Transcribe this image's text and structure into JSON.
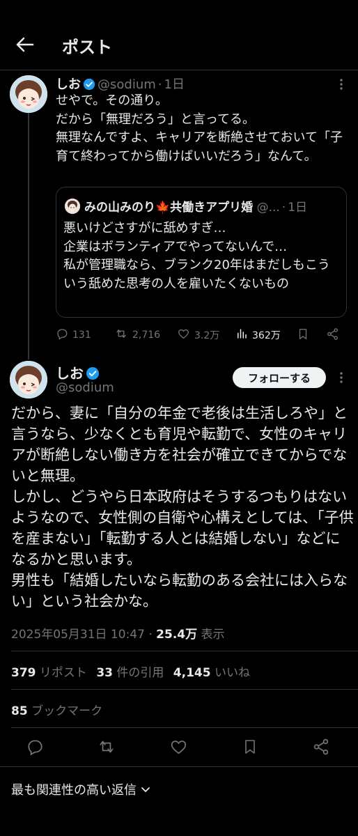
{
  "header": {
    "title": "ポスト"
  },
  "tweet1": {
    "name": "しお",
    "handle": "@sodium",
    "dot": "·",
    "time": "1日",
    "text": "せやで。その通り。\nだから「無理だろう」と言ってる。\n無理なんですよ、キャリアを断絶させておいて「子育て終わってから働けばいいだろう」なんて。",
    "quote": {
      "name": "みの山みのり🍁共働きアプリ婚",
      "handle": "@...",
      "dot": "·",
      "time": "1日",
      "text": "悪いけどさすがに舐めすぎ…\n企業はボランティアでやってないんで…\n私が管理職なら、ブランク20年はまだしもこういう舐めた思考の人を雇いたくないもの"
    },
    "actions": {
      "replies": "131",
      "reposts": "2,716",
      "likes": "3.2万",
      "views": "362万"
    }
  },
  "tweet2": {
    "name": "しお",
    "handle": "@sodium",
    "follow_label": "フォローする",
    "text": "だから、妻に「自分の年金で老後は生活しろや」と言うなら、少なくとも育児や転勤で、女性のキャリアが断絶しない働き方を社会が確立できてからでないと無理。\nしかし、どうやら日本政府はそうするつもりはないようなので、女性側の自衛や心構えとしては、「子供を産まない」「転勤する人とは結婚しない」などになるかと思います。\n男性も「結婚したいなら転勤のある会社には入らない」という社会かな。",
    "timestamp": "2025年05月31日 10:47",
    "sep": "·",
    "views": "25.4万",
    "views_label": "表示",
    "stats": {
      "reposts": "379",
      "reposts_label": "リポスト",
      "quotes": "33",
      "quotes_label": "件の引用",
      "likes": "4,145",
      "likes_label": "いいね",
      "bookmarks": "85",
      "bookmarks_label": "ブックマーク"
    }
  },
  "replies_sort": {
    "label": "最も関連性の高い返信"
  },
  "colors": {
    "background": "#000000",
    "text": "#e7e9ea",
    "muted": "#71767b",
    "verified": "#1d9bf0",
    "border": "#2f3336"
  },
  "icons": [
    "back-arrow-icon",
    "verified-icon",
    "more-icon",
    "reply-icon",
    "repost-icon",
    "like-icon",
    "views-icon",
    "bookmark-icon",
    "share-icon",
    "chevron-down-icon"
  ]
}
